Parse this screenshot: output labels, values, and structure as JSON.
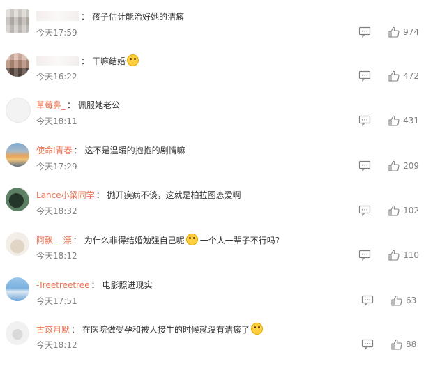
{
  "comments": [
    {
      "name": "",
      "text": "孩子估计能治好她的洁癖",
      "time": "今天17:59",
      "likes": "974",
      "avatar": "mosaic",
      "emoji": false
    },
    {
      "name": "",
      "text": "干嘛结婚",
      "time": "今天16:22",
      "likes": "472",
      "avatar": "mosaic2",
      "emoji": true
    },
    {
      "name": "草莓鼻_",
      "text": "佩服她老公",
      "time": "今天18:11",
      "likes": "431",
      "avatar": "light",
      "emoji": false
    },
    {
      "name": "使命I青春",
      "text": "这不是温暖的抱抱的剧情嘛",
      "time": "今天17:29",
      "likes": "209",
      "avatar": "sunset",
      "emoji": false
    },
    {
      "name": "Lance小梁同学",
      "text": "抛开疾病不谈，这就是柏拉图恋爱啊",
      "time": "今天18:32",
      "likes": "102",
      "avatar": "green",
      "emoji": false
    },
    {
      "name": "阿飘-_-漂",
      "text": "为什么非得结婚勉强自己呢",
      "text2": "一个人一辈子不行吗?",
      "time": "今天18:12",
      "likes": "110",
      "avatar": "pale",
      "emoji": true
    },
    {
      "name": "-Treetreetree",
      "text": "电影照进现实",
      "time": "今天17:51",
      "likes": "63",
      "avatar": "sky",
      "emoji": false
    },
    {
      "name": "古苡月默",
      "text": "在医院做受孕和被人接生的时候就没有洁癖了",
      "time": "今天18:12",
      "likes": "88",
      "avatar": "soft",
      "emoji": true
    }
  ]
}
